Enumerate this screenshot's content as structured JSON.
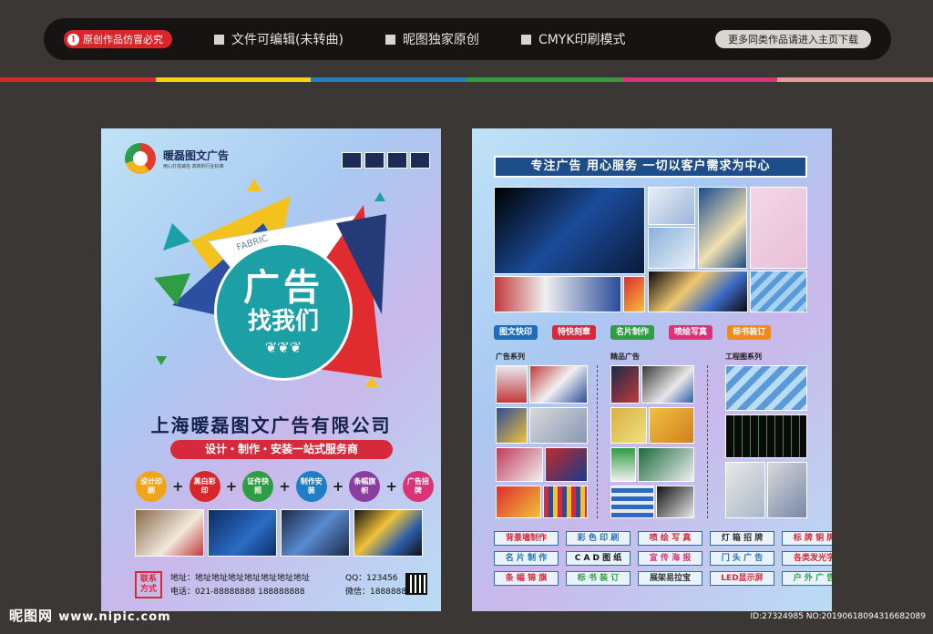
{
  "topbar": {
    "warning": "原创作品仿冒必究",
    "features": [
      "文件可编辑(未转曲)",
      "昵图独家原创",
      "CMYK印刷模式"
    ],
    "more_button": "更多同类作品请进入主页下载"
  },
  "left_flyer": {
    "logo_name": "暖磊图文广告",
    "logo_slogan": "用心打造诚信   高效的行业标准",
    "headline_1": "广告",
    "headline_2": "找我们",
    "card_text": "FABRIC",
    "company": "上海暖磊图文广告有限公司",
    "service_banner": "设计・制作・安装一站式服务商",
    "services": [
      {
        "label": "设计印刷",
        "color": "#f0a41b"
      },
      {
        "label": "黑白彩印",
        "color": "#d9262c"
      },
      {
        "label": "证件快照",
        "color": "#2e9d43"
      },
      {
        "label": "制作安装",
        "color": "#1f7ec4"
      },
      {
        "label": "条幅旗帜",
        "color": "#8a3fa0"
      },
      {
        "label": "广告招牌",
        "color": "#d9347a"
      }
    ],
    "contact_tag": "联系方式",
    "address": "地址：地址地址地址地址地址地址地址",
    "phone": "电话：021-88888888    188888888",
    "qq": "QQ：123456",
    "wechat": "微信：188888888"
  },
  "right_flyer": {
    "slogan": "专注广告  用心服务  一切以客户需求为中心",
    "tags": [
      {
        "label": "图文快印",
        "color": "#1f6fb8"
      },
      {
        "label": "特快刻章",
        "color": "#d62a3c"
      },
      {
        "label": "名片制作",
        "color": "#2e9d43"
      },
      {
        "label": "喷绘写真",
        "color": "#d9347a"
      },
      {
        "label": "标书装订",
        "color": "#f08a1b"
      }
    ],
    "col_titles": [
      "广告系列",
      "精品广告",
      "工程图系列"
    ],
    "captions": [
      {
        "label": "背景墙制作",
        "color": "#d62a3c"
      },
      {
        "label": "彩 色 印 刷",
        "color": "#1f6fb8"
      },
      {
        "label": "喷 绘 写 真",
        "color": "#d62a3c"
      },
      {
        "label": "灯 箱 招 牌",
        "color": "#333333"
      },
      {
        "label": "标 牌 铜 牌",
        "color": "#d62a3c"
      },
      {
        "label": "名 片 制 作",
        "color": "#1f6fb8"
      },
      {
        "label": "C A D 图 纸",
        "color": "#111111"
      },
      {
        "label": "宣 传 海 报",
        "color": "#d9347a"
      },
      {
        "label": "门 头 广 告",
        "color": "#1f6fb8"
      },
      {
        "label": "各类发光字",
        "color": "#d62a3c"
      },
      {
        "label": "条 幅 锦 旗",
        "color": "#d62a3c"
      },
      {
        "label": "标 书 装 订",
        "color": "#2e9d43"
      },
      {
        "label": "展架易拉宝",
        "color": "#333333"
      },
      {
        "label": "LED显示屏",
        "color": "#d62a3c"
      },
      {
        "label": "户 外 广 告",
        "color": "#2e9d43"
      }
    ]
  },
  "footer": {
    "site_name": "昵图网",
    "site_url": "www.nipic.com",
    "id_text": "ID:27324985 NO:20190618094316682089"
  }
}
